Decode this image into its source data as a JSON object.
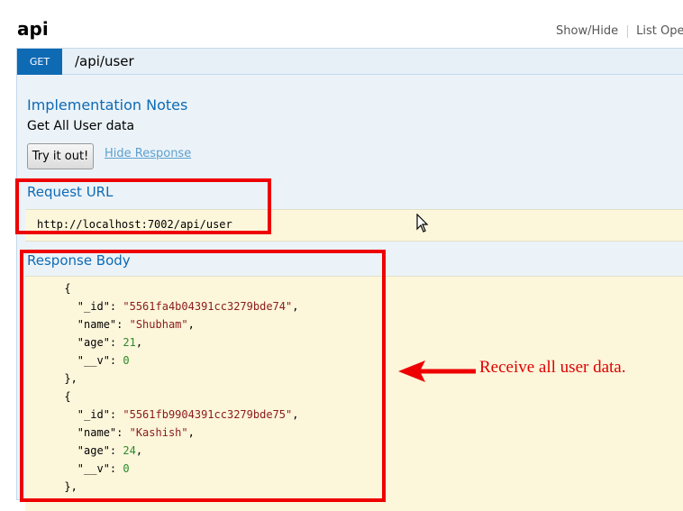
{
  "section": {
    "title": "api",
    "links": [
      "Show/Hide",
      "List Opera"
    ]
  },
  "operation": {
    "method": "GET",
    "path": "/api/user",
    "implementation_notes_title": "Implementation Notes",
    "implementation_notes_text": "Get All User data",
    "try_button": "Try it out!",
    "hide_response_link": "Hide Response",
    "request_url_title": "Request URL",
    "request_url": "http://localhost:7002/api/user",
    "response_body_title": "Response Body"
  },
  "response_lines": [
    {
      "indent": "      ",
      "parts": [
        {
          "t": "p",
          "v": "{"
        }
      ]
    },
    {
      "indent": "        ",
      "parts": [
        {
          "t": "k",
          "v": "\"_id\""
        },
        {
          "t": "p",
          "v": ": "
        },
        {
          "t": "s",
          "v": "\"5561fa4b04391cc3279bde74\""
        },
        {
          "t": "p",
          "v": ","
        }
      ]
    },
    {
      "indent": "        ",
      "parts": [
        {
          "t": "k",
          "v": "\"name\""
        },
        {
          "t": "p",
          "v": ": "
        },
        {
          "t": "s",
          "v": "\"Shubham\""
        },
        {
          "t": "p",
          "v": ","
        }
      ]
    },
    {
      "indent": "        ",
      "parts": [
        {
          "t": "k",
          "v": "\"age\""
        },
        {
          "t": "p",
          "v": ": "
        },
        {
          "t": "n",
          "v": "21"
        },
        {
          "t": "p",
          "v": ","
        }
      ]
    },
    {
      "indent": "        ",
      "parts": [
        {
          "t": "k",
          "v": "\"__v\""
        },
        {
          "t": "p",
          "v": ": "
        },
        {
          "t": "n",
          "v": "0"
        }
      ]
    },
    {
      "indent": "      ",
      "parts": [
        {
          "t": "p",
          "v": "},"
        }
      ]
    },
    {
      "indent": "      ",
      "parts": [
        {
          "t": "p",
          "v": "{"
        }
      ]
    },
    {
      "indent": "        ",
      "parts": [
        {
          "t": "k",
          "v": "\"_id\""
        },
        {
          "t": "p",
          "v": ": "
        },
        {
          "t": "s",
          "v": "\"5561fb9904391cc3279bde75\""
        },
        {
          "t": "p",
          "v": ","
        }
      ]
    },
    {
      "indent": "        ",
      "parts": [
        {
          "t": "k",
          "v": "\"name\""
        },
        {
          "t": "p",
          "v": ": "
        },
        {
          "t": "s",
          "v": "\"Kashish\""
        },
        {
          "t": "p",
          "v": ","
        }
      ]
    },
    {
      "indent": "        ",
      "parts": [
        {
          "t": "k",
          "v": "\"age\""
        },
        {
          "t": "p",
          "v": ": "
        },
        {
          "t": "n",
          "v": "24"
        },
        {
          "t": "p",
          "v": ","
        }
      ]
    },
    {
      "indent": "        ",
      "parts": [
        {
          "t": "k",
          "v": "\"__v\""
        },
        {
          "t": "p",
          "v": ": "
        },
        {
          "t": "n",
          "v": "0"
        }
      ]
    },
    {
      "indent": "      ",
      "parts": [
        {
          "t": "p",
          "v": "},"
        }
      ]
    }
  ],
  "annotation": {
    "text": "Receive all user data.",
    "color": "#ee0000"
  },
  "icons": [
    "arrow-left-icon",
    "mouse-cursor-icon"
  ]
}
